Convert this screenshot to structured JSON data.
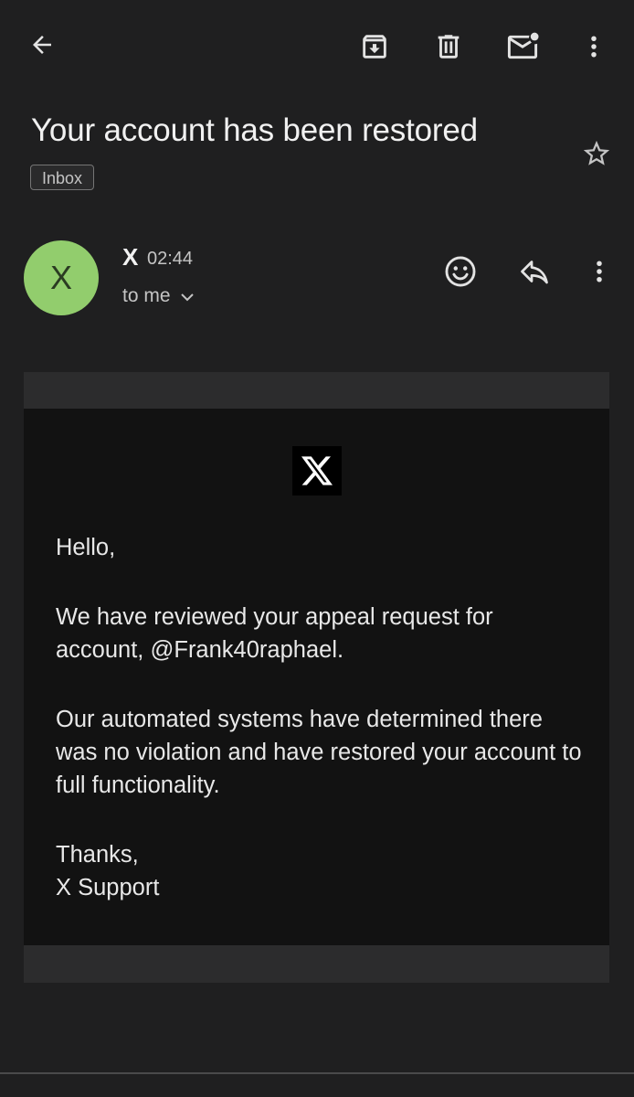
{
  "toolbar": {
    "back_icon": "arrow-left-icon",
    "archive_icon": "archive-icon",
    "delete_icon": "trash-icon",
    "mark_unread_icon": "mail-unread-icon",
    "more_icon": "more-vertical-icon"
  },
  "email": {
    "subject": "Your account has been restored",
    "label": "Inbox",
    "star_icon": "star-outline-icon"
  },
  "sender": {
    "avatar_letter": "X",
    "avatar_color": "#92cd6d",
    "name": "X",
    "time": "02:44",
    "recipient": "to me",
    "react_icon": "emoji-icon",
    "reply_icon": "reply-icon",
    "more_icon": "more-vertical-icon"
  },
  "message": {
    "logo": "x-logo-icon",
    "greeting": "Hello,",
    "paragraph1": "We have reviewed your appeal request for account, @Frank40raphael.",
    "paragraph2": "Our automated systems have determined there was no violation and have restored your account to full functionality.",
    "signoff_line1": "Thanks,",
    "signoff_line2": "X Support"
  }
}
